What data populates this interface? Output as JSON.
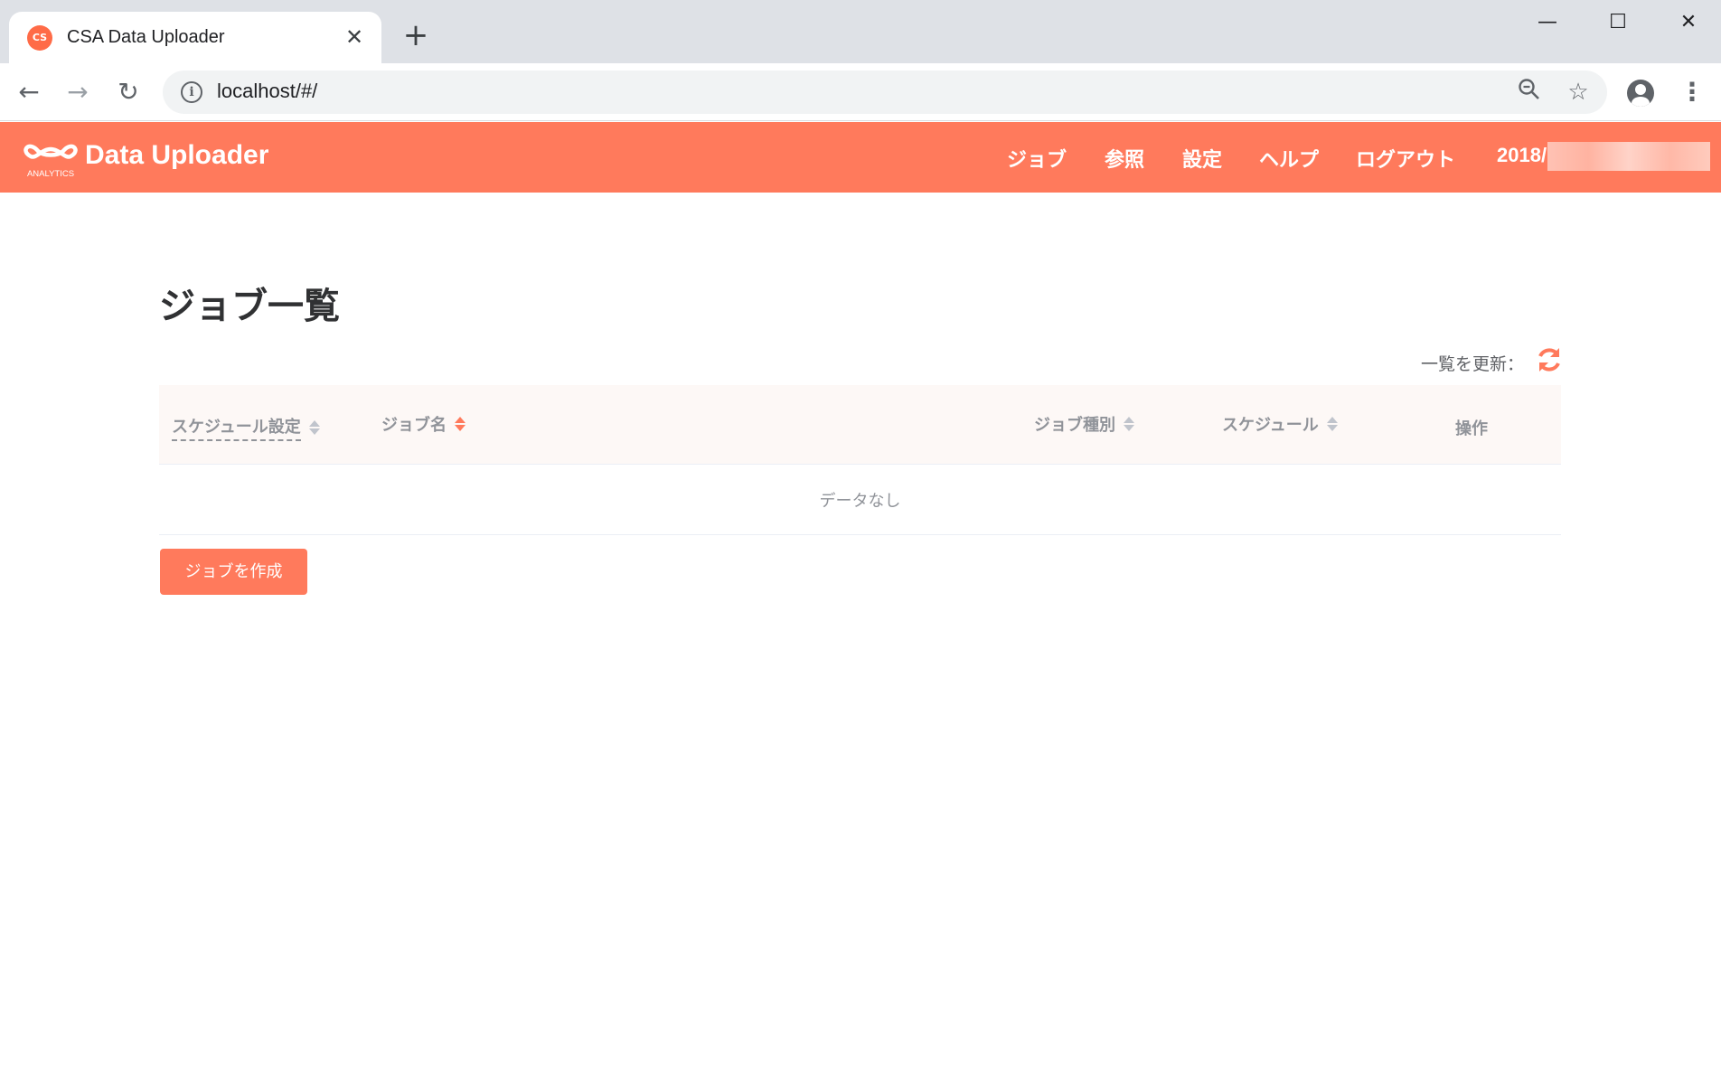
{
  "browser": {
    "tab_title": "CSA Data Uploader",
    "favicon_text": "CS",
    "url": "localhost/#/",
    "icons": {
      "close": "close-icon",
      "new_tab": "plus-icon",
      "back": "arrow-left-icon",
      "forward": "arrow-right-icon",
      "reload": "reload-icon",
      "info": "info-icon",
      "zoom": "zoom-out-icon",
      "bookmark": "star-icon",
      "profile": "account-icon",
      "menu": "kebab-menu-icon"
    }
  },
  "header": {
    "brand": "Data Uploader",
    "logo_sub": "ANALYTICS",
    "nav": [
      "ジョブ",
      "参照",
      "設定",
      "ヘルプ",
      "ログアウト"
    ],
    "date_prefix": "2018/"
  },
  "page": {
    "title": "ジョブ一覧",
    "refresh_label": "一覧を更新："
  },
  "table": {
    "columns": [
      "スケジュール設定",
      "ジョブ名",
      "ジョブ種別",
      "スケジュール",
      "操作"
    ],
    "empty_text": "データなし"
  },
  "buttons": {
    "create_job": "ジョブを作成"
  },
  "colors": {
    "brand": "#ff7a5c",
    "header_text": "#ffffff"
  }
}
